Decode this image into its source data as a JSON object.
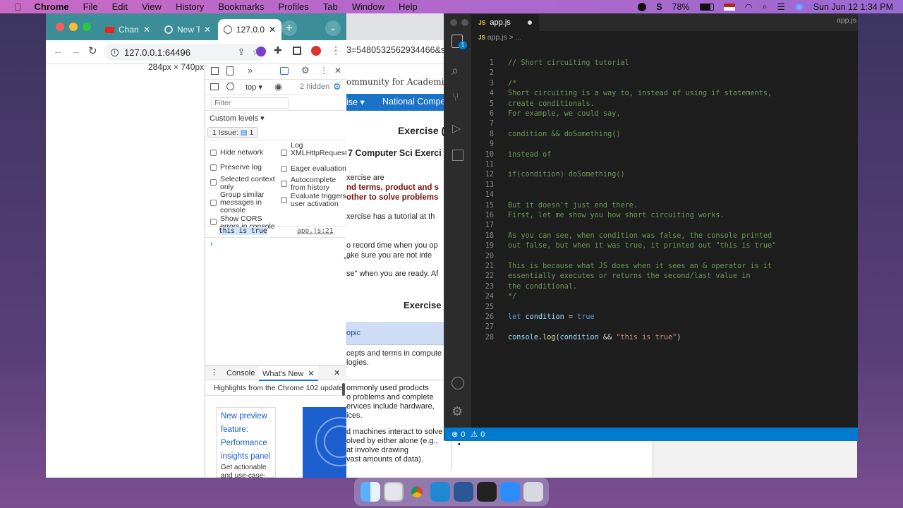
{
  "menubar": {
    "apple": "",
    "app": "Chrome",
    "items": [
      "File",
      "Edit",
      "View",
      "History",
      "Bookmarks",
      "Profiles",
      "Tab",
      "Window",
      "Help"
    ],
    "battery": "78%",
    "datetime": "Sun Jun 12  1:34 PM"
  },
  "chrome": {
    "tabs": [
      {
        "label": "Channel"
      },
      {
        "label": "New Ta"
      },
      {
        "label": "127.0.0"
      }
    ],
    "url": "127.0.0.1:64496",
    "viewport_size": "284px × 740px"
  },
  "devtools": {
    "context": "top",
    "hidden": "2 hidden",
    "filter_placeholder": "Filter",
    "levels": "Custom levels ▾",
    "issues_label": "1 Issue:",
    "issues_count": "1",
    "options_left": [
      "Hide network",
      "Preserve log",
      "Selected context only",
      "Group similar messages in console",
      "Show CORS errors in console"
    ],
    "options_right": [
      "Log XMLHttpRequests",
      "Eager evaluation",
      "Autocomplete from history",
      "Evaluate triggers user activation"
    ],
    "log_message": "this is true",
    "log_source": "app.js:21",
    "prompt": "›",
    "drawer_tabs": [
      "Console",
      "What's New"
    ],
    "highlights": "Highlights from the Chrome 102 update",
    "card_title_lines": [
      "New preview",
      "feature:",
      "Performance",
      "insights panel"
    ],
    "card_body": "Get actionable and use-case-driven insights"
  },
  "site": {
    "url_fragment": "3=5480532562934466&s",
    "org": "ommunity for Academic",
    "nav": [
      "ise ▾",
      "National Compe"
    ],
    "h1": "Exercise (",
    "h2": "7 Computer Sci Exerci",
    "p1": "xercise are",
    "p1b": "nd terms, product and s",
    "p1c": " other to solve problems",
    "p2": "xercise has a tutorial at th",
    "p3a": "o record time when you op",
    "p3b": "ake sure you are not inte",
    "p4": "se\" when you are ready. Af",
    "h3": "Exercise",
    "topic": "opic",
    "r1": "cepts and terms in compute\nlogies.",
    "r2": "ommonly used products\no problems and complete\nervices include hardware,\nices.",
    "r3": "d machines interact to solve\nolved by either alone (e.g.,\nat involve drawing\nvast amounts of data).",
    "bullet": "•"
  },
  "vscode": {
    "window_label": "app.js",
    "tab": "app.js",
    "breadcrumb": "app.js > ...",
    "status_errors": "0",
    "status_warnings": "0",
    "lines": [
      {
        "n": "1",
        "t": [
          [
            "cm",
            "// Short circuiting tutorial"
          ]
        ]
      },
      {
        "n": "2",
        "t": []
      },
      {
        "n": "3",
        "t": [
          [
            "cm",
            "/*"
          ]
        ]
      },
      {
        "n": "4",
        "t": [
          [
            "cm",
            "Short circuiting is a way to, instead of using if statements,"
          ]
        ]
      },
      {
        "n": "5",
        "t": [
          [
            "cm",
            "create conditionals."
          ]
        ]
      },
      {
        "n": "6",
        "t": [
          [
            "cm",
            "For example, we could say,"
          ]
        ]
      },
      {
        "n": "7",
        "t": []
      },
      {
        "n": "8",
        "t": [
          [
            "cm",
            "condition && doSomething()"
          ]
        ]
      },
      {
        "n": "9",
        "t": []
      },
      {
        "n": "10",
        "t": [
          [
            "cm",
            "instead of"
          ]
        ]
      },
      {
        "n": "11",
        "t": []
      },
      {
        "n": "12",
        "t": [
          [
            "cm",
            "if(condition) doSomething()"
          ]
        ]
      },
      {
        "n": "13",
        "t": []
      },
      {
        "n": "14",
        "t": []
      },
      {
        "n": "15",
        "t": [
          [
            "cm",
            "But it doesn't just end there."
          ]
        ]
      },
      {
        "n": "16",
        "t": [
          [
            "cm",
            "First, let me show you how short circuiting works."
          ]
        ]
      },
      {
        "n": "17",
        "t": []
      },
      {
        "n": "18",
        "t": [
          [
            "cm",
            "As you can see, when condition was false, the console printed"
          ]
        ]
      },
      {
        "n": "19",
        "t": [
          [
            "cm",
            "out false, but when it was true, it printed out \"this is true\""
          ]
        ]
      },
      {
        "n": "20",
        "t": []
      },
      {
        "n": "21",
        "t": [
          [
            "cm",
            "This is because what JS does when it sees an & operator is it"
          ]
        ]
      },
      {
        "n": "22",
        "t": [
          [
            "cm",
            "essentially executes or returns the second/last value in"
          ]
        ]
      },
      {
        "n": "23",
        "t": [
          [
            "cm",
            "the conditional."
          ]
        ]
      },
      {
        "n": "24",
        "t": [
          [
            "cm",
            "*/"
          ]
        ]
      },
      {
        "n": "25",
        "t": []
      },
      {
        "n": "26",
        "t": [
          [
            "kw",
            "let "
          ],
          [
            "vr",
            "condition"
          ],
          [
            "pl",
            " = "
          ],
          [
            "kw",
            "true"
          ]
        ]
      },
      {
        "n": "27",
        "t": []
      },
      {
        "n": "28",
        "t": [
          [
            "vr",
            "console"
          ],
          [
            "pl",
            "."
          ],
          [
            "fn",
            "log"
          ],
          [
            "pl",
            "("
          ],
          [
            "vr",
            "condition"
          ],
          [
            "pl",
            " && "
          ],
          [
            "st",
            "\"this is true\""
          ],
          [
            "pl",
            ")"
          ]
        ]
      }
    ]
  },
  "colors": {
    "tabstrip": "#3b8e97",
    "vscode_status": "#007acc",
    "site_nav": "#1a73c9"
  }
}
